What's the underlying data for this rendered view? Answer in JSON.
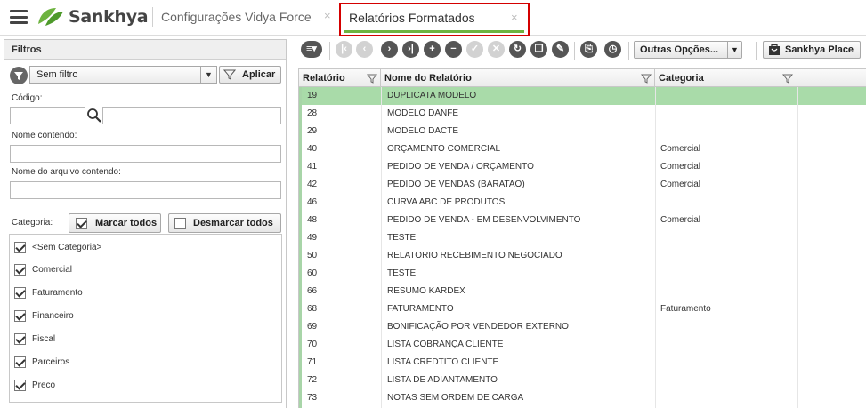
{
  "header": {
    "brand": "Sankhya",
    "tabs": [
      {
        "label": "Configurações Vidya Force",
        "close": "×"
      },
      {
        "label": "Relatórios Formatados",
        "close": "×"
      }
    ]
  },
  "filters": {
    "title": "Filtros",
    "filter_select_value": "Sem filtro",
    "apply_label": "Aplicar",
    "codigo_label": "Código:",
    "nome_label": "Nome contendo:",
    "arquivo_label": "Nome do arquivo contendo:",
    "categoria_label": "Categoria:",
    "marcar_todos": "Marcar todos",
    "desmarcar_todos": "Desmarcar todos",
    "categories": [
      {
        "label": "<Sem Categoria>",
        "checked": true
      },
      {
        "label": "Comercial",
        "checked": true
      },
      {
        "label": "Faturamento",
        "checked": true
      },
      {
        "label": "Financeiro",
        "checked": true
      },
      {
        "label": "Fiscal",
        "checked": true
      },
      {
        "label": "Parceiros",
        "checked": true
      },
      {
        "label": "Preco",
        "checked": true
      }
    ]
  },
  "toolbar": {
    "outras_opcoes": "Outras Opções...",
    "sankhya_place": "Sankhya Place"
  },
  "grid": {
    "columns": [
      "Relatório",
      "Nome do Relatório",
      "Categoria"
    ],
    "rows": [
      {
        "id": "19",
        "name": "DUPLICATA MODELO",
        "category": "",
        "selected": true
      },
      {
        "id": "28",
        "name": "MODELO DANFE",
        "category": ""
      },
      {
        "id": "29",
        "name": "MODELO DACTE",
        "category": ""
      },
      {
        "id": "40",
        "name": "ORÇAMENTO COMERCIAL",
        "category": "Comercial"
      },
      {
        "id": "41",
        "name": "PEDIDO DE VENDA / ORÇAMENTO",
        "category": "Comercial"
      },
      {
        "id": "42",
        "name": "PEDIDO DE VENDAS (BARATAO)",
        "category": "Comercial"
      },
      {
        "id": "46",
        "name": "CURVA ABC DE PRODUTOS",
        "category": ""
      },
      {
        "id": "48",
        "name": "PEDIDO DE VENDA - EM DESENVOLVIMENTO",
        "category": "Comercial"
      },
      {
        "id": "49",
        "name": "TESTE",
        "category": ""
      },
      {
        "id": "50",
        "name": "RELATORIO RECEBIMENTO NEGOCIADO",
        "category": ""
      },
      {
        "id": "60",
        "name": "TESTE",
        "category": ""
      },
      {
        "id": "66",
        "name": "RESUMO KARDEX",
        "category": ""
      },
      {
        "id": "68",
        "name": "FATURAMENTO",
        "category": "Faturamento"
      },
      {
        "id": "69",
        "name": "BONIFICAÇÃO POR VENDEDOR EXTERNO",
        "category": ""
      },
      {
        "id": "70",
        "name": "LISTA COBRANÇA CLIENTE",
        "category": ""
      },
      {
        "id": "71",
        "name": "LISTA CREDTITO CLIENTE",
        "category": ""
      },
      {
        "id": "72",
        "name": "LISTA DE ADIANTAMENTO",
        "category": ""
      },
      {
        "id": "73",
        "name": "NOTAS SEM ORDEM DE CARGA",
        "category": ""
      }
    ]
  }
}
